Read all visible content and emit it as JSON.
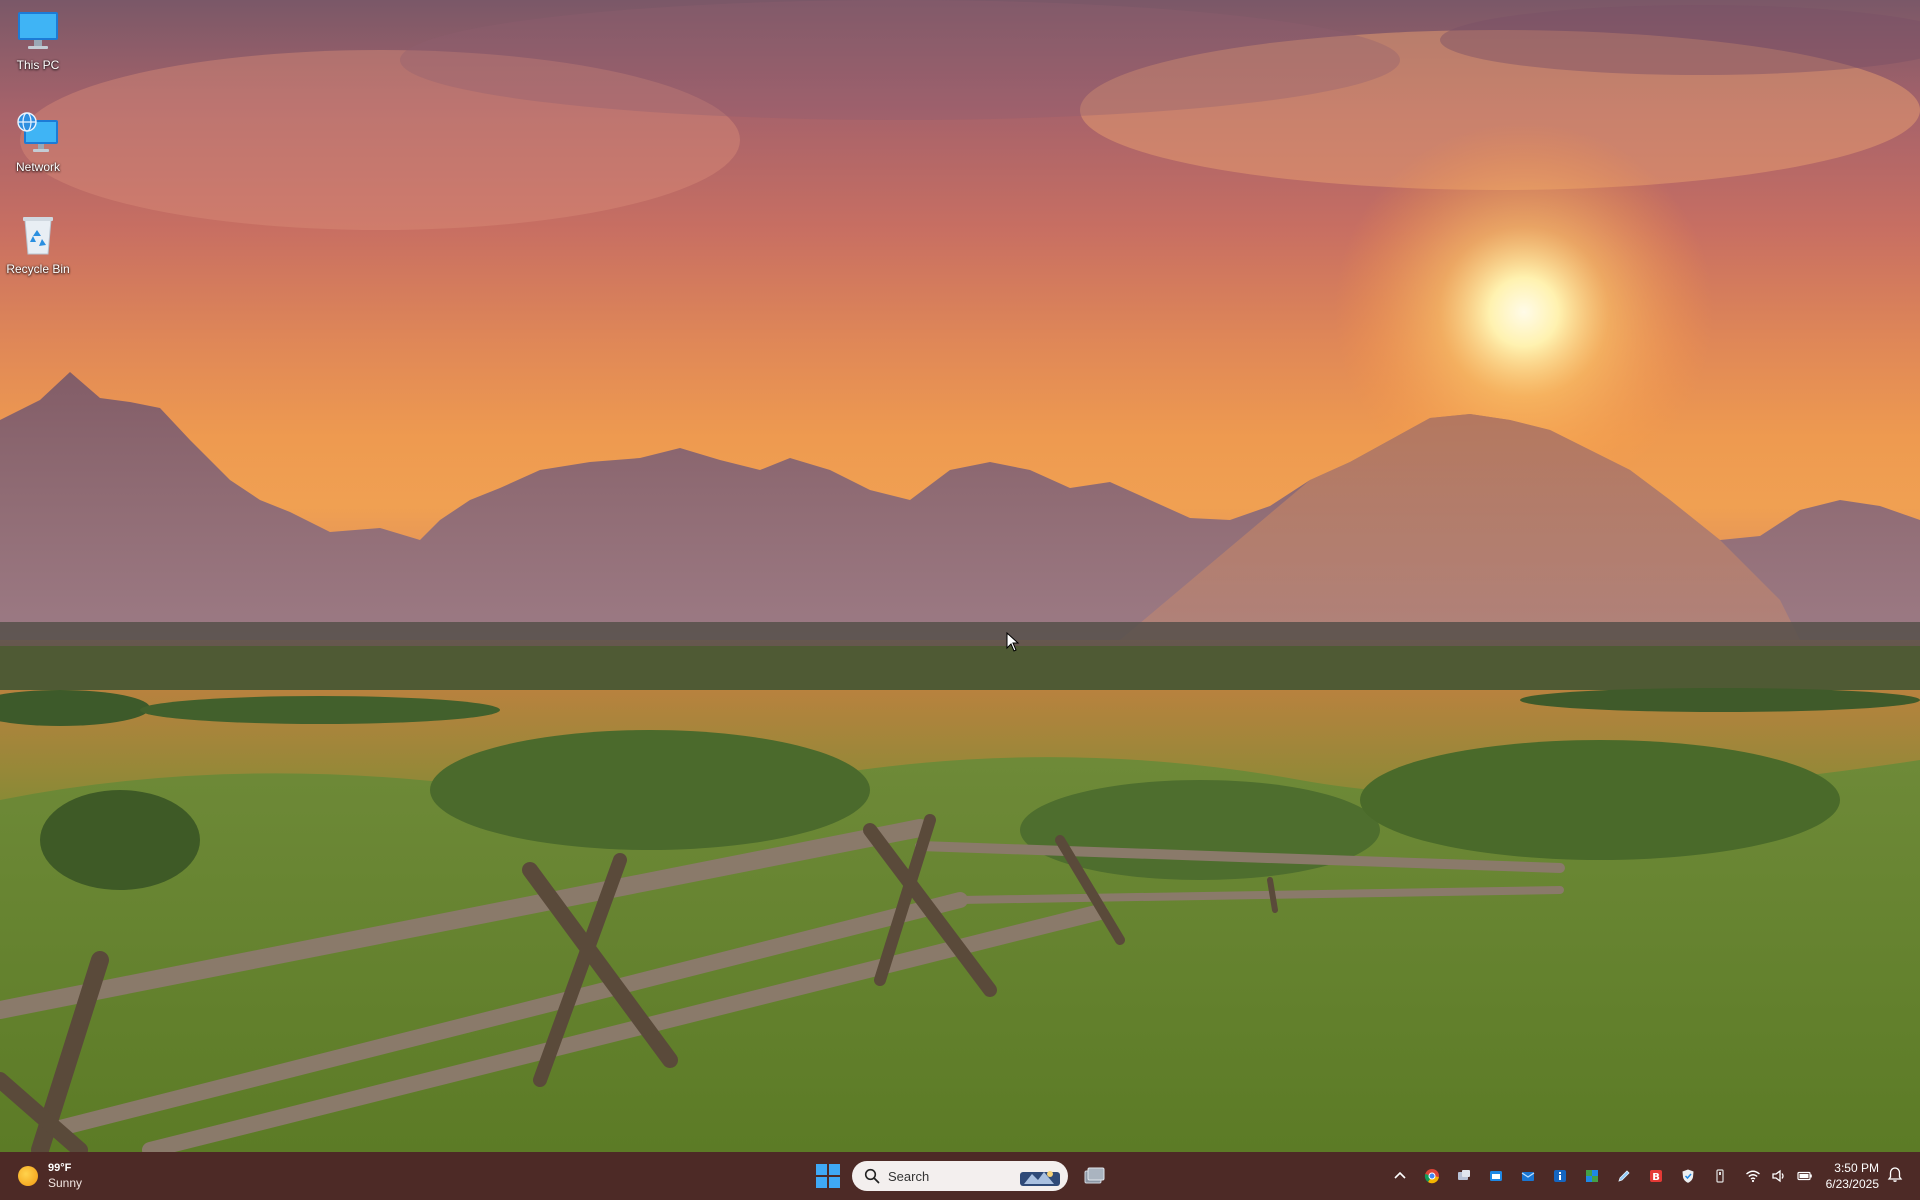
{
  "desktop": {
    "icons": [
      {
        "label": "This PC",
        "icon": "monitor-icon"
      },
      {
        "label": "Network",
        "icon": "network-globe-icon"
      },
      {
        "label": "Recycle Bin",
        "icon": "recycle-bin-icon"
      }
    ]
  },
  "taskbar": {
    "weather": {
      "temp": "99°F",
      "condition": "Sunny",
      "icon": "sun-icon"
    },
    "search": {
      "placeholder": "Search"
    },
    "tray_icons": [
      "chevron-up-icon",
      "chrome-icon",
      "teams-icon",
      "store-icon",
      "mail-icon",
      "info-icon",
      "grid-app-icon",
      "pen-icon",
      "b-app-icon",
      "shield-icon",
      "usb-icon"
    ],
    "system_icons": [
      "wifi-icon",
      "speaker-icon",
      "battery-icon"
    ],
    "clock": {
      "time": "3:50 PM",
      "date": "6/23/2025"
    },
    "colors": {
      "taskbar_bg": "#4d2a26",
      "start_accent": "#3fa9f5"
    }
  }
}
